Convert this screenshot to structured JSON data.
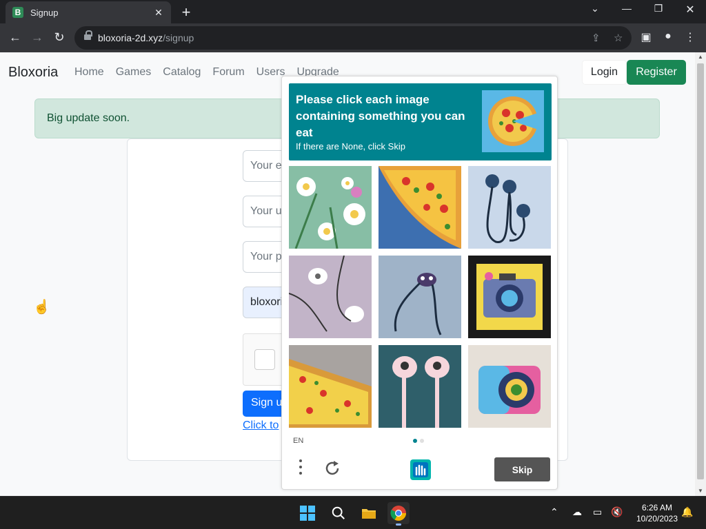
{
  "browser": {
    "tab_title": "Signup",
    "tab_favicon_letter": "B",
    "new_tab_symbol": "+",
    "url_domain": "bloxoria-2d.xyz",
    "url_path": "/signup"
  },
  "site": {
    "brand": "Bloxoria",
    "nav": [
      "Home",
      "Games",
      "Catalog",
      "Forum",
      "Users",
      "Upgrade"
    ],
    "login_label": "Login",
    "register_label": "Register",
    "alert": "Big update soon."
  },
  "form": {
    "email_placeholder": "Your e",
    "username_placeholder": "Your u",
    "password_placeholder": "Your p",
    "autofill_value": "bloxori",
    "signup_label": "Sign u",
    "login_link": "Click to"
  },
  "captcha": {
    "prompt": "Please click each image containing something you can eat",
    "sub": "If there are None, click Skip",
    "language": "EN",
    "skip_label": "Skip",
    "accent_color": "#00838f",
    "tiles": [
      "flowers",
      "pizza",
      "earphones",
      "earbuds",
      "earphones",
      "camera",
      "pizza",
      "earbuds",
      "camera"
    ]
  },
  "taskbar": {
    "time": "6:26 AM",
    "date": "10/20/2023"
  }
}
